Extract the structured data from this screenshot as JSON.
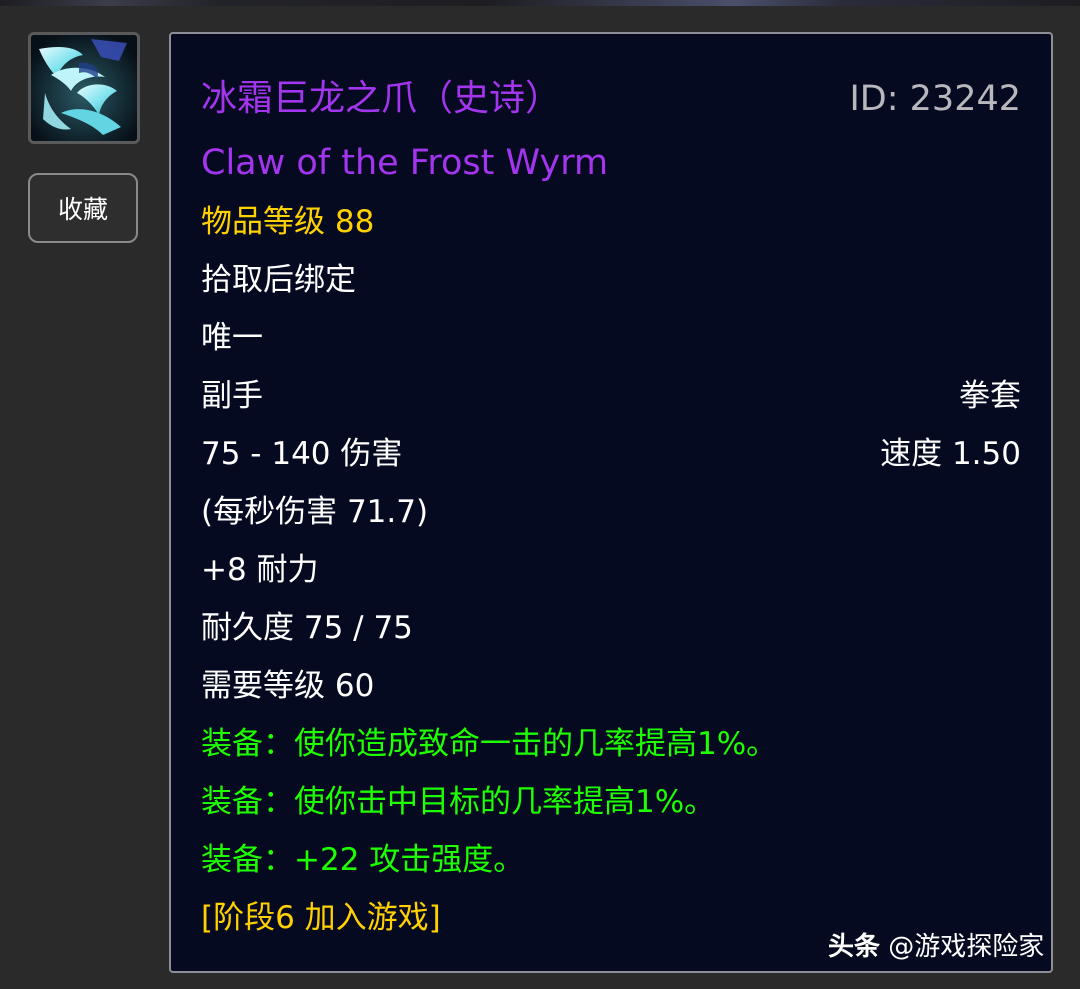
{
  "item": {
    "name_cn": "冰霜巨龙之爪（史诗）",
    "name_en": "Claw of the Frost Wyrm",
    "id_text": "ID: 23242",
    "item_level": "物品等级 88",
    "binding": "拾取后绑定",
    "unique": "唯一",
    "slot": "副手",
    "type": "拳套",
    "damage": "75 - 140 伤害",
    "speed": "速度 1.50",
    "dps": "(每秒伤害 71.7)",
    "stamina": "+8 耐力",
    "durability": "耐久度 75 / 75",
    "required_level": "需要等级 60",
    "effects": [
      "装备：使你造成致命一击的几率提高1%。",
      "装备：使你击中目标的几率提高1%。",
      "装备：+22 攻击强度。"
    ],
    "phase": "[阶段6 加入游戏]",
    "icon": "frost-wyrm-claw-icon"
  },
  "favorite_button": {
    "label": "收藏"
  },
  "watermark": {
    "brand": "头条",
    "handle": "@游戏探险家"
  },
  "colors": {
    "epic": "#a335ee",
    "item_level": "#ffd100",
    "equip_effect": "#1eff00",
    "tooltip_bg": "#060a21",
    "page_bg": "#2a2a2a"
  }
}
